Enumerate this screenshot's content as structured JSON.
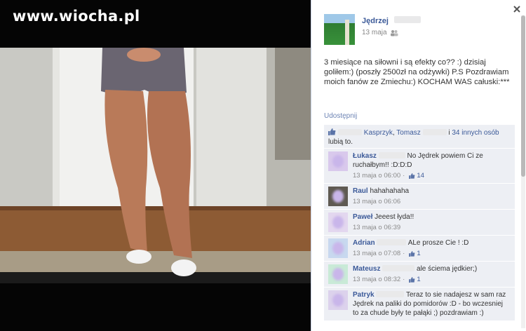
{
  "watermark": "www.wiocha.pl",
  "post": {
    "author": "Jędrzej",
    "date": "13 maja",
    "text": "3 miesiące na siłowni i są efekty co?? :) dzisiaj goliłem:) (poszły 2500zł na odżywki) P.S Pozdrawiam moich fanów ze Zmiechu:) KOCHAM WAS całuski:***",
    "share": "Udostępnij"
  },
  "likes": {
    "name1": "Kasprzyk",
    "comma": ",",
    "name2": "Tomasz",
    "connector": "i",
    "others": "34 innych osób",
    "suffix": "lubią to."
  },
  "comments": [
    {
      "name": "Łukasz",
      "text": "No Jędrek powiem Ci ze ruchałbym!! :D:D:D",
      "time": "13 maja o 06:00",
      "likes": "14",
      "pic": "#d9c9ec"
    },
    {
      "name": "Raul",
      "text": "hahahahaha",
      "time": "13 maja o 06:06",
      "likes": "",
      "pic": "#5f5a52"
    },
    {
      "name": "Paweł",
      "text": "Jeeest łyda!!",
      "time": "13 maja o 06:39",
      "likes": "",
      "pic": "#e3d7ef"
    },
    {
      "name": "Adrian",
      "text": "ALe prosze Cie ! :D",
      "time": "13 maja o 07:08",
      "likes": "1",
      "pic": "#c8d8ef"
    },
    {
      "name": "Mateusz",
      "text": "ale ściema jędkier;)",
      "time": "13 maja o 08:32",
      "likes": "1",
      "pic": "#c9ead7"
    },
    {
      "name": "Patryk",
      "text": "Teraz to sie nadajesz w sam raz Jędrek na paliki do pomidorów :D - bo wczesniej to za chude były te pałąki ;) pozdrawiam :)",
      "time": "",
      "likes": "",
      "pic": "#dcd2ec"
    }
  ]
}
